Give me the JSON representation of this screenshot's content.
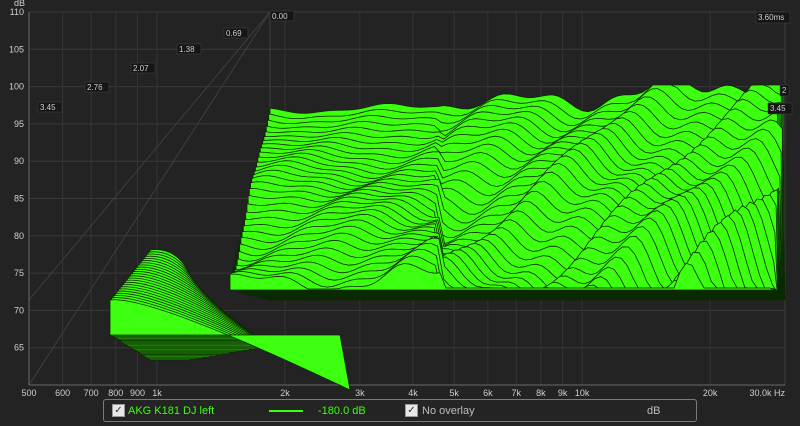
{
  "chart_data": {
    "type": "area",
    "subtype": "waterfall-3d",
    "series_color": "#3dff10",
    "series": [
      {
        "name": "AKG K181 DJ left",
        "values": []
      }
    ],
    "ylabel": "dB",
    "ylim": [
      60,
      110
    ],
    "y_ticks": [
      "65",
      "70",
      "75",
      "80",
      "85",
      "90",
      "95",
      "100",
      "105",
      "110"
    ],
    "xlabel": "Hz",
    "x_scale": "log",
    "xlim": [
      500,
      30000
    ],
    "x_ticks": [
      {
        "value": 500,
        "label": "500"
      },
      {
        "value": 600,
        "label": "600"
      },
      {
        "value": 700,
        "label": "700"
      },
      {
        "value": 800,
        "label": "800"
      },
      {
        "value": 900,
        "label": "900"
      },
      {
        "value": 1000,
        "label": "1k"
      },
      {
        "value": 2000,
        "label": "2k"
      },
      {
        "value": 3000,
        "label": "3k"
      },
      {
        "value": 4000,
        "label": "4k"
      },
      {
        "value": 5000,
        "label": "5k"
      },
      {
        "value": 6000,
        "label": "6k"
      },
      {
        "value": 7000,
        "label": "7k"
      },
      {
        "value": 8000,
        "label": "8k"
      },
      {
        "value": 9000,
        "label": "9k"
      },
      {
        "value": 10000,
        "label": "10k"
      },
      {
        "value": 20000,
        "label": "20k"
      },
      {
        "value": 30000,
        "label": "30.0k Hz"
      }
    ],
    "time_axis_unit": "ms",
    "time_ticks": [
      {
        "value": 0.0,
        "label": "0.00"
      },
      {
        "value": 0.69,
        "label": "0.69"
      },
      {
        "value": 1.38,
        "label": "1.38"
      },
      {
        "value": 2.07,
        "label": "2.07"
      },
      {
        "value": 2.76,
        "label": "2.76"
      },
      {
        "value": 3.45,
        "label": "3.45"
      }
    ],
    "time_ticks_right": [
      {
        "value": 3.6,
        "label": "3.60ms"
      },
      {
        "value": 3.45,
        "label": "3.45"
      },
      {
        "value": 2.76,
        "label": "2"
      }
    ],
    "grid": true
  },
  "legend": {
    "series_checked": true,
    "series_label": "AKG K181 DJ left",
    "level": "-180.0 dB",
    "overlay_checked": true,
    "overlay_label": "No overlay",
    "unit": "dB"
  }
}
